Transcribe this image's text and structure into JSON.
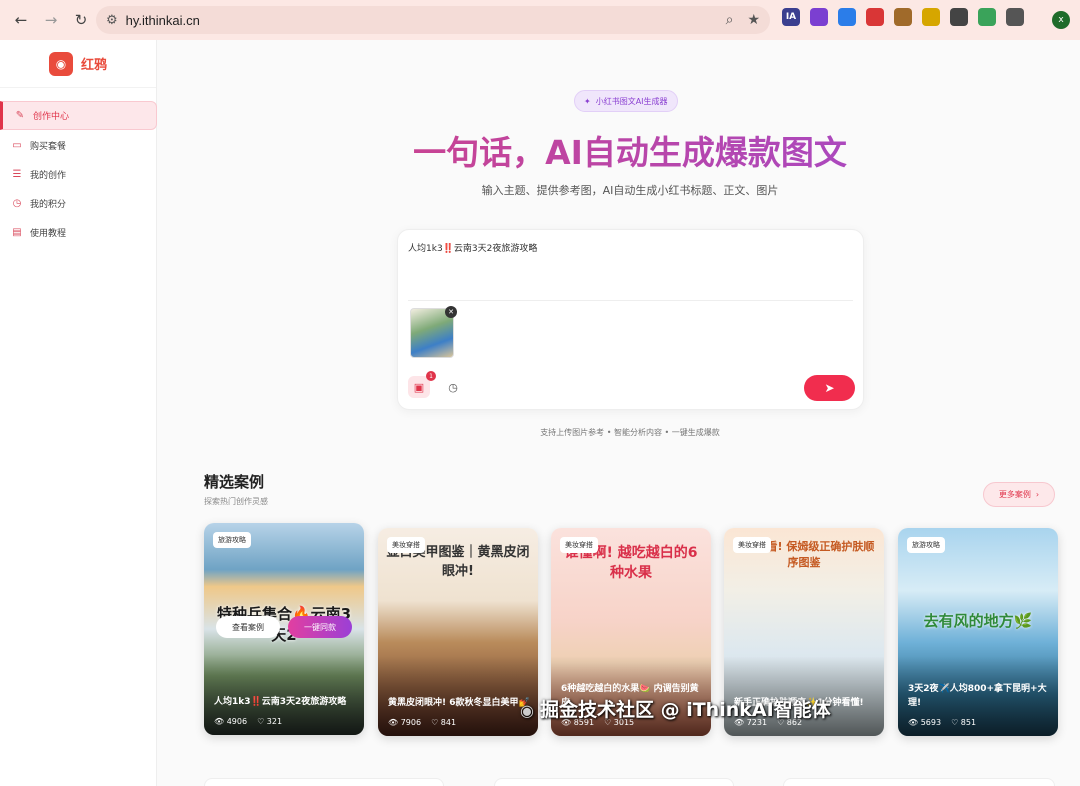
{
  "browser": {
    "url": "hy.ithinkai.cn",
    "back_icon": "←",
    "forward_icon": "→",
    "reload_icon": "↻",
    "profile_initial": "x",
    "extensions": [
      {
        "name": "ia-ext",
        "label": "IA",
        "color": "#3b3f8f"
      },
      {
        "name": "ext-2",
        "label": "",
        "color": "#7b3fd1"
      },
      {
        "name": "translate-ext",
        "label": "",
        "color": "#2b7de9"
      },
      {
        "name": "pokeball-ext",
        "label": "",
        "color": "#d93636"
      },
      {
        "name": "cookie-ext",
        "label": "",
        "color": "#a06a2a"
      },
      {
        "name": "ext-6",
        "label": "",
        "color": "#d6a600"
      },
      {
        "name": "ext-7",
        "label": "",
        "color": "#444444"
      },
      {
        "name": "ext-8",
        "label": "",
        "color": "#3aa35a"
      },
      {
        "name": "puzzle-ext",
        "label": "",
        "color": "#555555"
      }
    ]
  },
  "sidebar": {
    "brand": "红鸦",
    "items": [
      {
        "label": "创作中心",
        "icon": "✎",
        "active": true
      },
      {
        "label": "购买套餐",
        "icon": "▭",
        "active": false
      },
      {
        "label": "我的创作",
        "icon": "☰",
        "active": false
      },
      {
        "label": "我的积分",
        "icon": "◷",
        "active": false
      },
      {
        "label": "使用教程",
        "icon": "▤",
        "active": false
      }
    ]
  },
  "hero": {
    "pill": "小红书图文AI生成器",
    "headline": "一句话，AI自动生成爆款图文",
    "subhead": "输入主题、提供参考图，AI自动生成小红书标题、正文、图片"
  },
  "composer": {
    "text": "人均1k3‼️云南3天2夜旅游攻略",
    "image_count": "1"
  },
  "features": "支持上传图片参考 • 智能分析内容 • 一键生成爆款",
  "gallery": {
    "title": "精选案例",
    "subtitle": "探索热门创作灵感",
    "more": "更多案例",
    "view_case": "查看案例",
    "one_click": "一键同款",
    "cards": [
      {
        "tag": "旅游攻略",
        "headline": "特种兵集合🔥云南3天2",
        "title": "人均1k3‼️云南3天2夜旅游攻略",
        "views": "4906",
        "likes": "321"
      },
      {
        "tag": "美妆穿搭",
        "headline": "显白美甲图鉴｜黄黑皮闭眼冲!",
        "title": "黄黑皮闭眼冲! 6款秋冬显白美甲💅",
        "views": "7906",
        "likes": "841"
      },
      {
        "tag": "美妆穿搭",
        "headline": "谁懂啊! 越吃越白的6种水果",
        "title": "6种越吃越白的水果🍉 内调告别黄皮",
        "views": "8591",
        "likes": "3015"
      },
      {
        "tag": "美妆穿搭",
        "headline": "新手必看! 保姆级正确护肤顺序图鉴",
        "title": "新手正确护肤顺序✨1分钟看懂!",
        "views": "7231",
        "likes": "862"
      },
      {
        "tag": "旅游攻略",
        "headline": "去有风的地方🌿",
        "title": "3天2夜✈️人均800+拿下昆明+大理!",
        "views": "5693",
        "likes": "851"
      }
    ]
  },
  "watermark": "掘金技术社区 @ iThinkAI智能体"
}
